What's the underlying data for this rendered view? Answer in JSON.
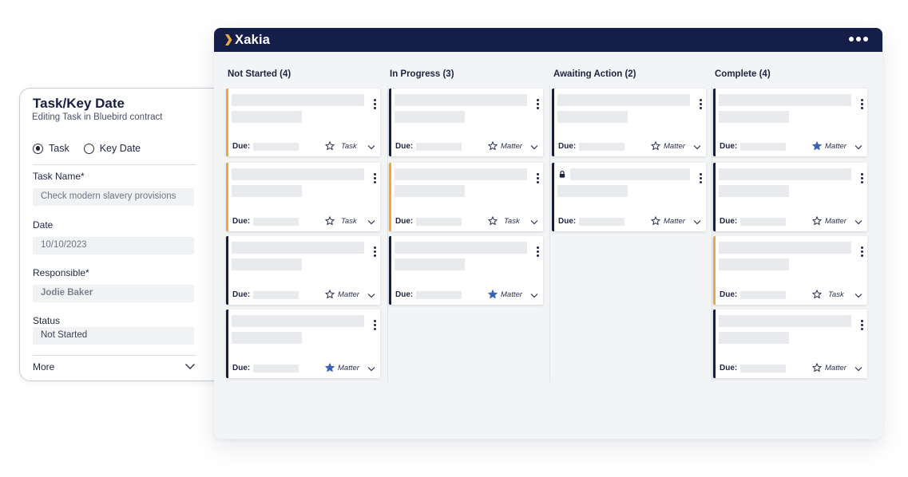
{
  "form": {
    "title": "Task/Key Date",
    "subtitle": "Editing Task in Bluebird contract",
    "radio_task": "Task",
    "radio_key_date": "Key Date",
    "task_name_label": "Task Name*",
    "task_name_value": "Check modern slavery provisions",
    "date_label": "Date",
    "date_value": "10/10/2023",
    "responsible_label": "Responsible*",
    "responsible_value": "Jodie Baker",
    "status_label": "Status",
    "status_value": "Not Started",
    "more_label": "More"
  },
  "app": {
    "logo": "Xakia",
    "brand_navy": "#141e49",
    "accent_orange": "#f0a73a",
    "starred_color": "#3b63b8"
  },
  "columns": [
    {
      "title": "Not Started (4)",
      "cards": [
        {
          "due_label": "Due:",
          "type": "Task",
          "starred": false,
          "accent": "orange"
        },
        {
          "due_label": "Due:",
          "type": "Task",
          "starred": false,
          "accent": "orange"
        },
        {
          "due_label": "Due:",
          "type": "Matter",
          "starred": false,
          "accent": "navy"
        },
        {
          "due_label": "Due:",
          "type": "Matter",
          "starred": true,
          "accent": "navy"
        }
      ]
    },
    {
      "title": "In Progress (3)",
      "cards": [
        {
          "due_label": "Due:",
          "type": "Matter",
          "starred": false,
          "accent": "navy"
        },
        {
          "due_label": "Due:",
          "type": "Task",
          "starred": false,
          "accent": "orange"
        },
        {
          "due_label": "Due:",
          "type": "Matter",
          "starred": true,
          "accent": "navy"
        }
      ]
    },
    {
      "title": "Awaiting Action (2)",
      "cards": [
        {
          "due_label": "Due:",
          "type": "Matter",
          "starred": false,
          "accent": "navy"
        },
        {
          "due_label": "Due:",
          "type": "Matter",
          "starred": false,
          "accent": "navy",
          "locked": true
        }
      ]
    },
    {
      "title": "Complete (4)",
      "cards": [
        {
          "due_label": "Due:",
          "type": "Matter",
          "starred": true,
          "accent": "navy"
        },
        {
          "due_label": "Due:",
          "type": "Matter",
          "starred": false,
          "accent": "navy"
        },
        {
          "due_label": "Due:",
          "type": "Task",
          "starred": false,
          "accent": "orange"
        },
        {
          "due_label": "Due:",
          "type": "Matter",
          "starred": false,
          "accent": "navy"
        }
      ]
    }
  ]
}
